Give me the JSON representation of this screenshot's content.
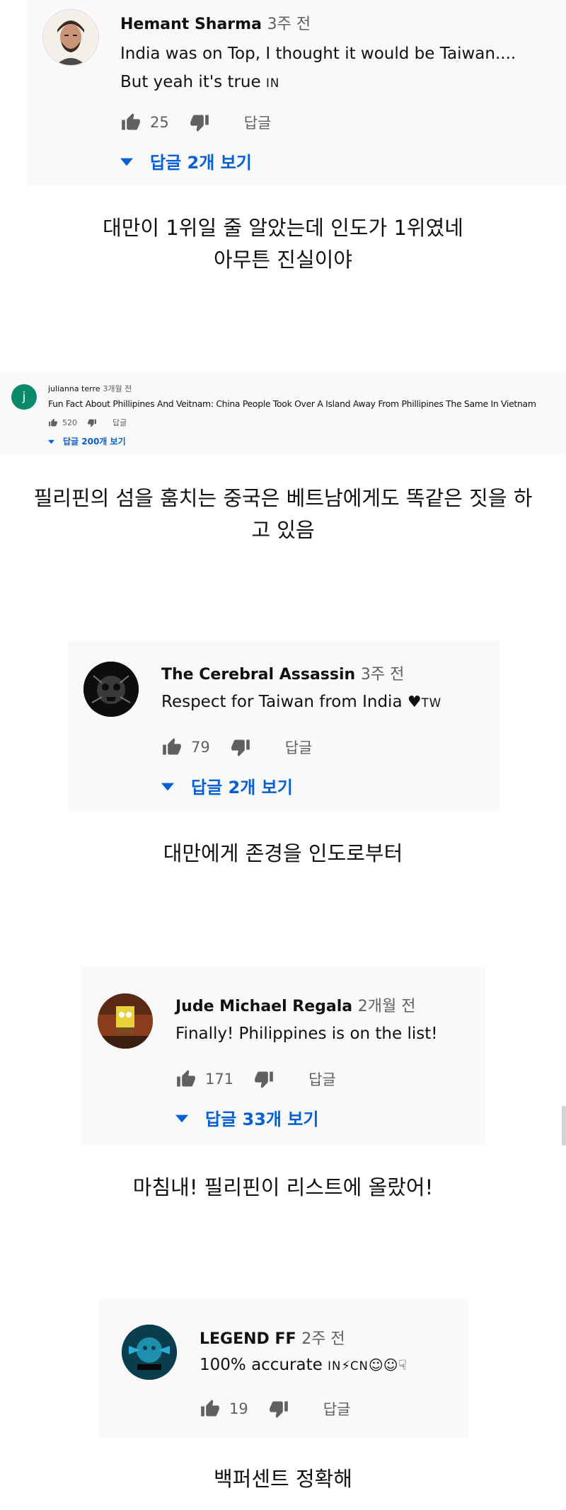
{
  "comments": [
    {
      "author": "Hemant Sharma",
      "time": "3주 전",
      "text_line1": "India was on Top, I thought it would be Taiwan....",
      "text_line2": "But yeah it's true",
      "flag": "IN",
      "likes": "25",
      "reply_label": "답글",
      "view_replies": "답글 2개 보기"
    },
    {
      "avatar_letter": "j",
      "author": "julianna terre",
      "time": "3개월 전",
      "text": "Fun Fact About Phillipines And Veitnam: China People Took Over A Island Away From Phillipines The Same In Vietnam",
      "likes": "520",
      "reply_label": "답글",
      "view_replies": "답글 200개 보기"
    },
    {
      "author": "The Cerebral Assassin",
      "time": "3주 전",
      "text": "Respect for Taiwan from India",
      "flag": "TW",
      "likes": "79",
      "reply_label": "답글",
      "view_replies": "답글 2개 보기"
    },
    {
      "author": "Jude Michael Regala",
      "time": "2개월 전",
      "text": "Finally! Philippines is on the list!",
      "likes": "171",
      "reply_label": "답글",
      "view_replies": "답글 33개 보기"
    },
    {
      "author": "LEGEND FF",
      "time": "2주 전",
      "text": "100% accurate",
      "flag_in": "IN",
      "flag_cn": "CN",
      "likes": "19",
      "reply_label": "답글"
    }
  ],
  "captions": [
    {
      "line1": "대만이 1위일 줄 알았는데 인도가 1위였네",
      "line2": "아무튼 진실이야"
    },
    {
      "line1": "필리핀의 섬을 훔치는 중국은 베트남에게도 똑같은 짓을 하",
      "line2": "고 있음"
    },
    {
      "line1": "대만에게 존경을 인도로부터"
    },
    {
      "line1": "마침내! 필리핀이 리스트에 올랐어!"
    },
    {
      "line1": "백퍼센트 정확해"
    }
  ],
  "colors": {
    "card_bg": "#f9f9f9",
    "link_blue": "#065fd4",
    "meta_gray": "#606060",
    "avatar_teal": "#0b8a6b"
  },
  "icons": [
    "thumbs-up-icon",
    "thumbs-down-icon",
    "caret-down-icon",
    "heart-icon",
    "lightning-icon",
    "laughing-emoji-icon",
    "pointing-hand-icon"
  ]
}
